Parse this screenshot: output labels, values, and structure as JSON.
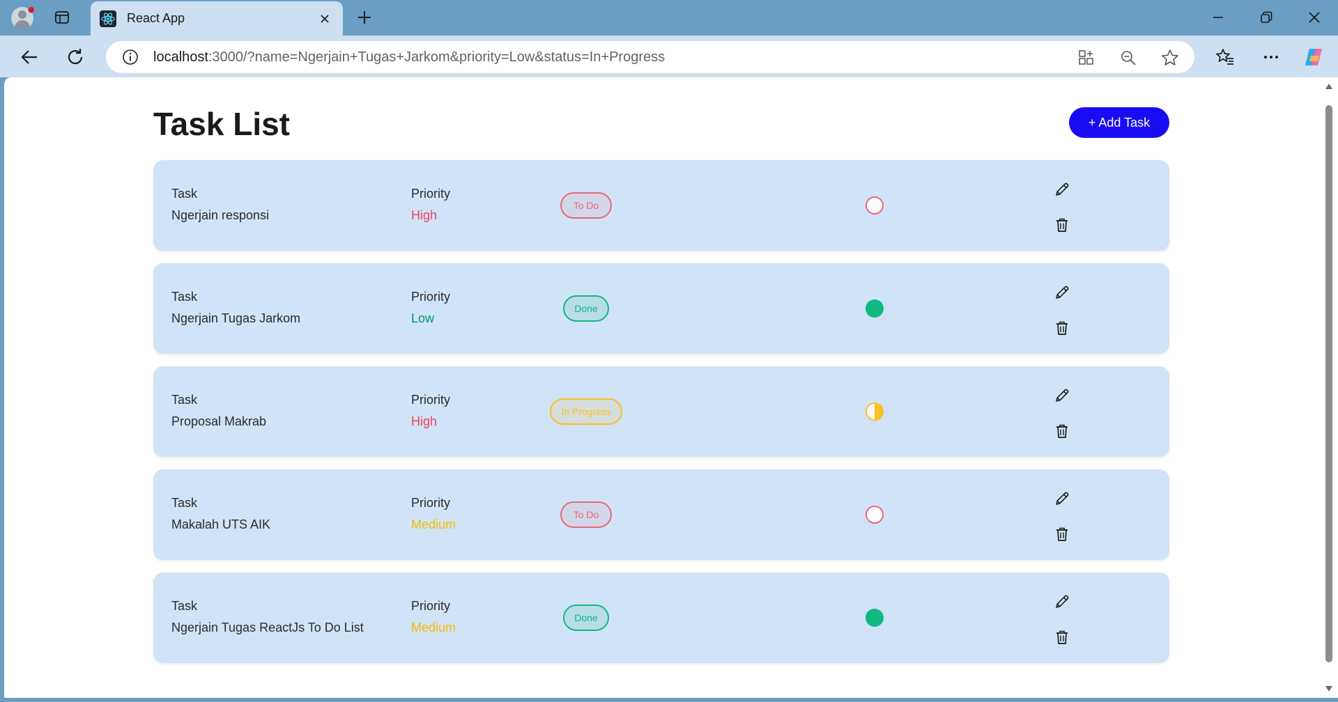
{
  "browser": {
    "tab_title": "React App",
    "url_host": "localhost",
    "url_rest": ":3000/?name=Ngerjain+Tugas+Jarkom&priority=Low&status=In+Progress"
  },
  "page": {
    "title": "Task List",
    "add_button_label": "+ Add Task",
    "task_col_label": "Task",
    "priority_col_label": "Priority"
  },
  "colors": {
    "accent": "#1a0cf0",
    "card": "#d1e3f6",
    "todo": "#e8677a",
    "done": "#10b981",
    "in_progress": "#fbbf24",
    "priority_high": "#e8465e",
    "priority_low": "#059669",
    "priority_medium": "#f5b800"
  },
  "tasks": [
    {
      "name": "Ngerjain responsi",
      "priority": "High",
      "status": "To Do"
    },
    {
      "name": "Ngerjain Tugas Jarkom",
      "priority": "Low",
      "status": "Done"
    },
    {
      "name": "Proposal Makrab",
      "priority": "High",
      "status": "In Progress"
    },
    {
      "name": "Makalah UTS AIK",
      "priority": "Medium",
      "status": "To Do"
    },
    {
      "name": "Ngerjain Tugas ReactJs To Do List",
      "priority": "Medium",
      "status": "Done"
    }
  ]
}
